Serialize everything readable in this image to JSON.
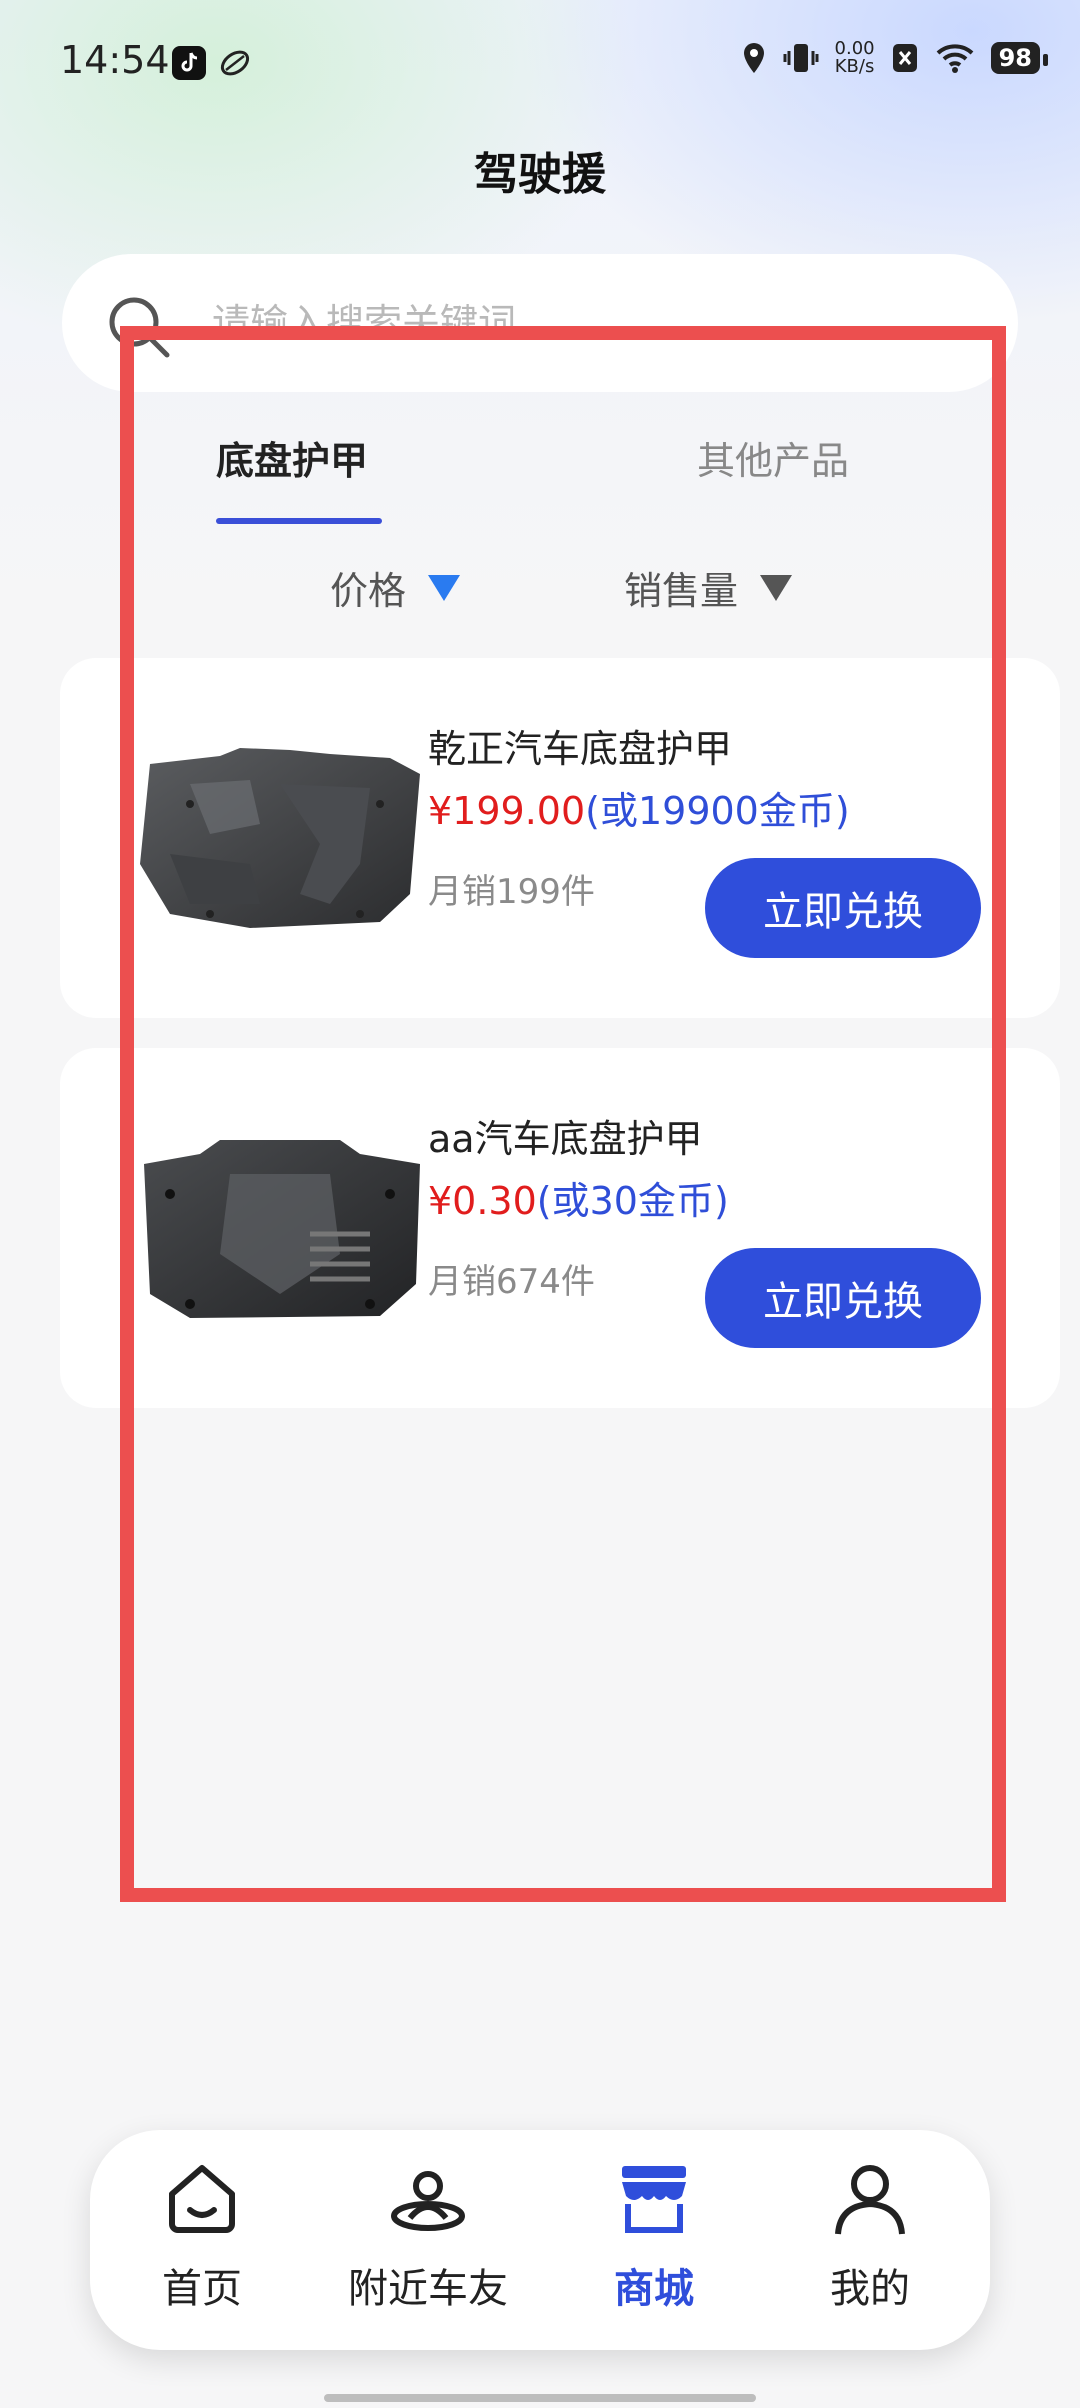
{
  "status_bar": {
    "time": "14:54",
    "network_speed_value": "0.00",
    "network_speed_unit": "KB/s",
    "battery": "98"
  },
  "header": {
    "title": "驾驶援"
  },
  "search": {
    "placeholder": "请输入搜索关键词"
  },
  "tabs": [
    {
      "label": "底盘护甲",
      "active": true
    },
    {
      "label": "其他产品",
      "active": false
    }
  ],
  "sort": {
    "price_label": "价格",
    "sales_label": "销售量",
    "price_arrow_color": "#2a7bf0",
    "sales_arrow_color": "#555555"
  },
  "products": [
    {
      "name": "乾正汽车底盘护甲",
      "price_rmb": "¥199.00",
      "price_coins": "(或19900金币)",
      "sales": "月销199件",
      "button": "立即兑换"
    },
    {
      "name": "aa汽车底盘护甲",
      "price_rmb": "¥0.30",
      "price_coins": "(或30金币)",
      "sales": "月销674件",
      "button": "立即兑换"
    }
  ],
  "bottom_nav": [
    {
      "label": "首页",
      "icon": "home-icon",
      "active": false
    },
    {
      "label": "附近车友",
      "icon": "nearby-friends-icon",
      "active": false
    },
    {
      "label": "商城",
      "icon": "shop-icon",
      "active": true
    },
    {
      "label": "我的",
      "icon": "profile-icon",
      "active": false
    }
  ],
  "colors": {
    "accent": "#2f4edb",
    "price_red": "#e11d1d",
    "highlight_border": "#ec4f4f"
  }
}
